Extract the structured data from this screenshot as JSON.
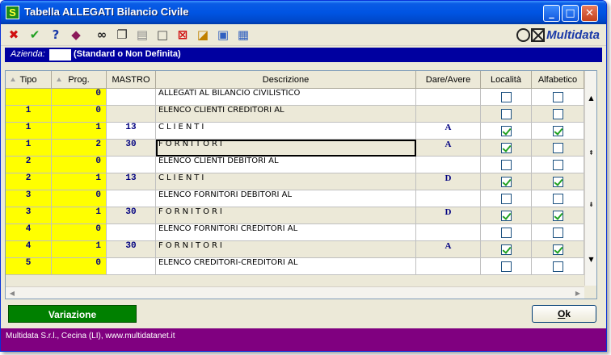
{
  "window": {
    "title": "Tabella ALLEGATI Bilancio Civile",
    "app_icon": "S",
    "colors": {
      "titlebar": "#0054e3",
      "azienda_bar": "#0000a0",
      "status_bar": "#800080",
      "key_cells": "#ffff00",
      "variazione": "#008000"
    }
  },
  "toolbar": {
    "icons": [
      "delete-x-icon",
      "confirm-check-icon",
      "help-question-icon",
      "book-icon",
      "binoculars-search-icon",
      "copy-icon",
      "paste-icon",
      "new-page-icon",
      "cancel-record-icon",
      "edit-ruler-icon",
      "window-tile-icon",
      "export-icon"
    ],
    "logo_text": "Multidata"
  },
  "azienda": {
    "label": "Azienda:",
    "code": "",
    "value": "(Standard o Non Definita)"
  },
  "grid": {
    "columns": {
      "tipo": "Tipo",
      "prog": "Prog.",
      "mastro": "MASTRO",
      "descrizione": "Descrizione",
      "dare_avere": "Dare/Avere",
      "localita": "Località",
      "alfabetico": "Alfabetico"
    },
    "rows": [
      {
        "tipo": "",
        "prog": "0",
        "mastro": "",
        "descrizione": "ALLEGATI AL BILANCIO CIVILISTICO",
        "spaced": false,
        "dare_avere": "",
        "localita": false,
        "alfabetico": false
      },
      {
        "tipo": "1",
        "prog": "0",
        "mastro": "",
        "descrizione": "ELENCO CLIENTI CREDITORI AL",
        "spaced": false,
        "dare_avere": "",
        "localita": false,
        "alfabetico": false
      },
      {
        "tipo": "1",
        "prog": "1",
        "mastro": "13",
        "descrizione": "CLIENTI",
        "spaced": true,
        "dare_avere": "A",
        "localita": true,
        "alfabetico": true
      },
      {
        "tipo": "1",
        "prog": "2",
        "mastro": "30",
        "descrizione": "FORNITORI",
        "spaced": true,
        "dare_avere": "A",
        "localita": true,
        "alfabetico": false
      },
      {
        "tipo": "2",
        "prog": "0",
        "mastro": "",
        "descrizione": "ELENCO CLIENTI DEBITORI AL",
        "spaced": false,
        "dare_avere": "",
        "localita": false,
        "alfabetico": false
      },
      {
        "tipo": "2",
        "prog": "1",
        "mastro": "13",
        "descrizione": "CLIENTI",
        "spaced": true,
        "dare_avere": "D",
        "localita": true,
        "alfabetico": true
      },
      {
        "tipo": "3",
        "prog": "0",
        "mastro": "",
        "descrizione": "ELENCO FORNITORI DEBITORI AL",
        "spaced": false,
        "dare_avere": "",
        "localita": false,
        "alfabetico": false
      },
      {
        "tipo": "3",
        "prog": "1",
        "mastro": "30",
        "descrizione": "FORNITORI",
        "spaced": true,
        "dare_avere": "D",
        "localita": true,
        "alfabetico": true
      },
      {
        "tipo": "4",
        "prog": "0",
        "mastro": "",
        "descrizione": "ELENCO FORNITORI CREDITORI AL",
        "spaced": false,
        "dare_avere": "",
        "localita": false,
        "alfabetico": false
      },
      {
        "tipo": "4",
        "prog": "1",
        "mastro": "30",
        "descrizione": "FORNITORI",
        "spaced": true,
        "dare_avere": "A",
        "localita": true,
        "alfabetico": true
      },
      {
        "tipo": "5",
        "prog": "0",
        "mastro": "",
        "descrizione": "ELENCO CREDITORI-CREDITORI AL",
        "spaced": false,
        "dare_avere": "",
        "localita": false,
        "alfabetico": false
      }
    ],
    "selected_row": 3
  },
  "buttons": {
    "variazione": "Variazione",
    "ok_underlined": "O",
    "ok_rest": "k"
  },
  "status": {
    "text": "Multidata S.r.l., Cecina (LI), www.multidatanet.it"
  }
}
